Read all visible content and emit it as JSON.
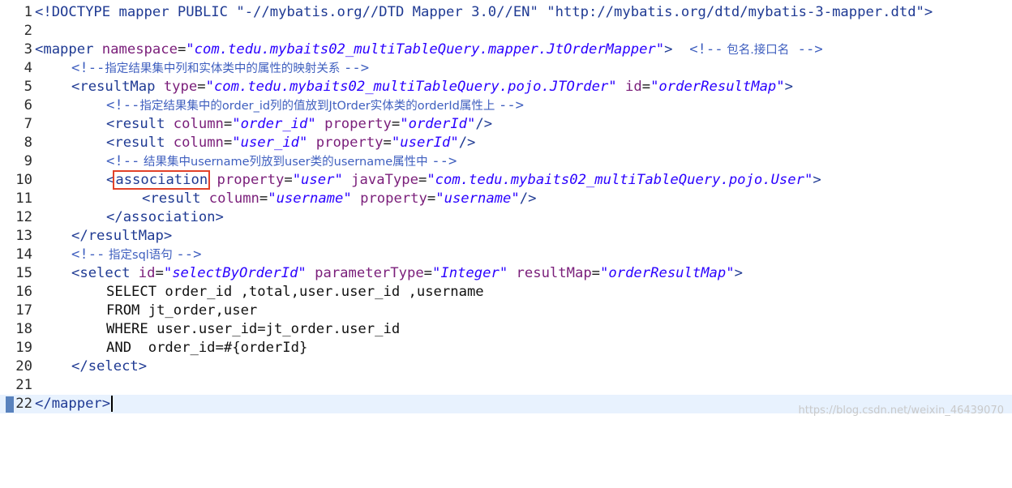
{
  "editor": {
    "lines": [
      {
        "num": "1"
      },
      {
        "num": "2"
      },
      {
        "num": "3"
      },
      {
        "num": "4"
      },
      {
        "num": "5"
      },
      {
        "num": "6"
      },
      {
        "num": "7"
      },
      {
        "num": "8"
      },
      {
        "num": "9"
      },
      {
        "num": "10"
      },
      {
        "num": "11"
      },
      {
        "num": "12"
      },
      {
        "num": "13"
      },
      {
        "num": "14"
      },
      {
        "num": "15"
      },
      {
        "num": "16"
      },
      {
        "num": "17"
      },
      {
        "num": "18"
      },
      {
        "num": "19"
      },
      {
        "num": "20"
      },
      {
        "num": "21"
      },
      {
        "num": "22"
      }
    ],
    "doctype": {
      "open": "<!DOCTYPE mapper PUBLIC ",
      "public_id": "\"-//mybatis.org//DTD Mapper 3.0//EN\"",
      "system_id": "\"http://mybatis.org/dtd/mybatis-3-mapper.dtd\"",
      "close": ">"
    },
    "mapper_open": {
      "tag": "<mapper ",
      "attr": "namespace",
      "value": "\"com.tedu.mybaits02_multiTableQuery.mapper.JtOrderMapper\"",
      "close": ">",
      "comment_open": "<!--",
      "comment_text": " 包名.接口名",
      "comment_close": "-->"
    },
    "comment4": {
      "open": "<!--",
      "text": "指定结果集中列和实体类中的属性的映射关系 ",
      "close": "-->"
    },
    "resultmap_open": {
      "tag": "<resultMap ",
      "attr1": "type",
      "val1": "\"com.tedu.mybaits02_multiTableQuery.pojo.JTOrder\"",
      "attr2": "id",
      "val2": "\"orderResultMap\"",
      "close": ">"
    },
    "comment6": {
      "open": "<!--",
      "text": "指定结果集中的order_id列的值放到JtOrder实体类的orderId属性上 ",
      "close": "-->"
    },
    "result7": {
      "tag": "<result ",
      "attr1": "column",
      "val1": "\"order_id\"",
      "attr2": "property",
      "val2": "\"orderId\"",
      "close": "/>"
    },
    "result8": {
      "tag": "<result ",
      "attr1": "column",
      "val1": "\"user_id\"",
      "attr2": "property",
      "val2": "\"userId\"",
      "close": "/>"
    },
    "comment9": {
      "open": "<!--",
      "text": " 结果集中username列放到user类的username属性中 ",
      "close": "-->"
    },
    "association_open": {
      "lt": "<",
      "tag": "association",
      "attr1": "property",
      "val1": "\"user\"",
      "attr2": "javaType",
      "val2": "\"com.tedu.mybaits02_multiTableQuery.pojo.User\"",
      "close": ">"
    },
    "result11": {
      "tag": "<result ",
      "attr1": "column",
      "val1": "\"username\"",
      "attr2": "property",
      "val2": "\"username\"",
      "close": "/>"
    },
    "association_close": "</association>",
    "resultmap_close": "</resultMap>",
    "comment14": {
      "open": "<!--",
      "text": " 指定sql语句 ",
      "close": "-->"
    },
    "select_open": {
      "tag": "<select ",
      "attr1": "id",
      "val1": "\"selectByOrderId\"",
      "attr2": "parameterType",
      "val2": "\"Integer\"",
      "attr3": "resultMap",
      "val3": "\"orderResultMap\"",
      "close": ">"
    },
    "sql16": "SELECT order_id ,total,user.user_id ,username",
    "sql17": "FROM jt_order,user",
    "sql18": "WHERE user.user_id=jt_order.user_id",
    "sql19": "AND  order_id=#{orderId}",
    "select_close": "</select>",
    "mapper_close": "</mapper>"
  },
  "watermark": "https://blog.csdn.net/weixin_46439070"
}
